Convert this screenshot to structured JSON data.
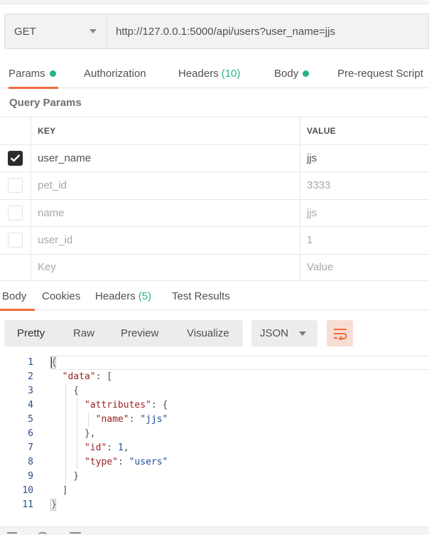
{
  "request": {
    "method": "GET",
    "url": "http://127.0.0.1:5000/api/users?user_name=jjs"
  },
  "request_tabs": [
    {
      "label": "Params",
      "dot": true,
      "active": true
    },
    {
      "label": "Authorization"
    },
    {
      "label": "Headers",
      "count": "(10)"
    },
    {
      "label": "Body",
      "dot": true
    },
    {
      "label": "Pre-request Script"
    }
  ],
  "query_params": {
    "title": "Query Params",
    "headers": {
      "key": "KEY",
      "value": "VALUE"
    },
    "rows": [
      {
        "key": "user_name",
        "value": "jjs",
        "checked": true
      },
      {
        "key": "pet_id",
        "value": "3333",
        "checked": false
      },
      {
        "key": "name",
        "value": "jjs",
        "checked": false
      },
      {
        "key": "user_id",
        "value": "1",
        "checked": false
      }
    ],
    "placeholder": {
      "key": "Key",
      "value": "Value"
    }
  },
  "response_tabs": [
    {
      "label": "Body",
      "active": true
    },
    {
      "label": "Cookies"
    },
    {
      "label": "Headers",
      "count": "(5)"
    },
    {
      "label": "Test Results"
    }
  ],
  "format_buttons": [
    "Pretty",
    "Raw",
    "Preview",
    "Visualize"
  ],
  "format_select": "JSON",
  "colors": {
    "accent": "#f26b3a",
    "green": "#26b47f",
    "key": "#9b1f1f",
    "string": "#1f4e9b"
  },
  "code": {
    "line_numbers": [
      "1",
      "2",
      "3",
      "4",
      "5",
      "6",
      "7",
      "8",
      "9",
      "10",
      "11"
    ],
    "lines": [
      "{",
      "  \"data\": [",
      "    {",
      "      \"attributes\": {",
      "        \"name\": \"jjs\"",
      "      },",
      "      \"id\": 1,",
      "      \"type\": \"users\"",
      "    }",
      "  ]",
      "}"
    ]
  }
}
